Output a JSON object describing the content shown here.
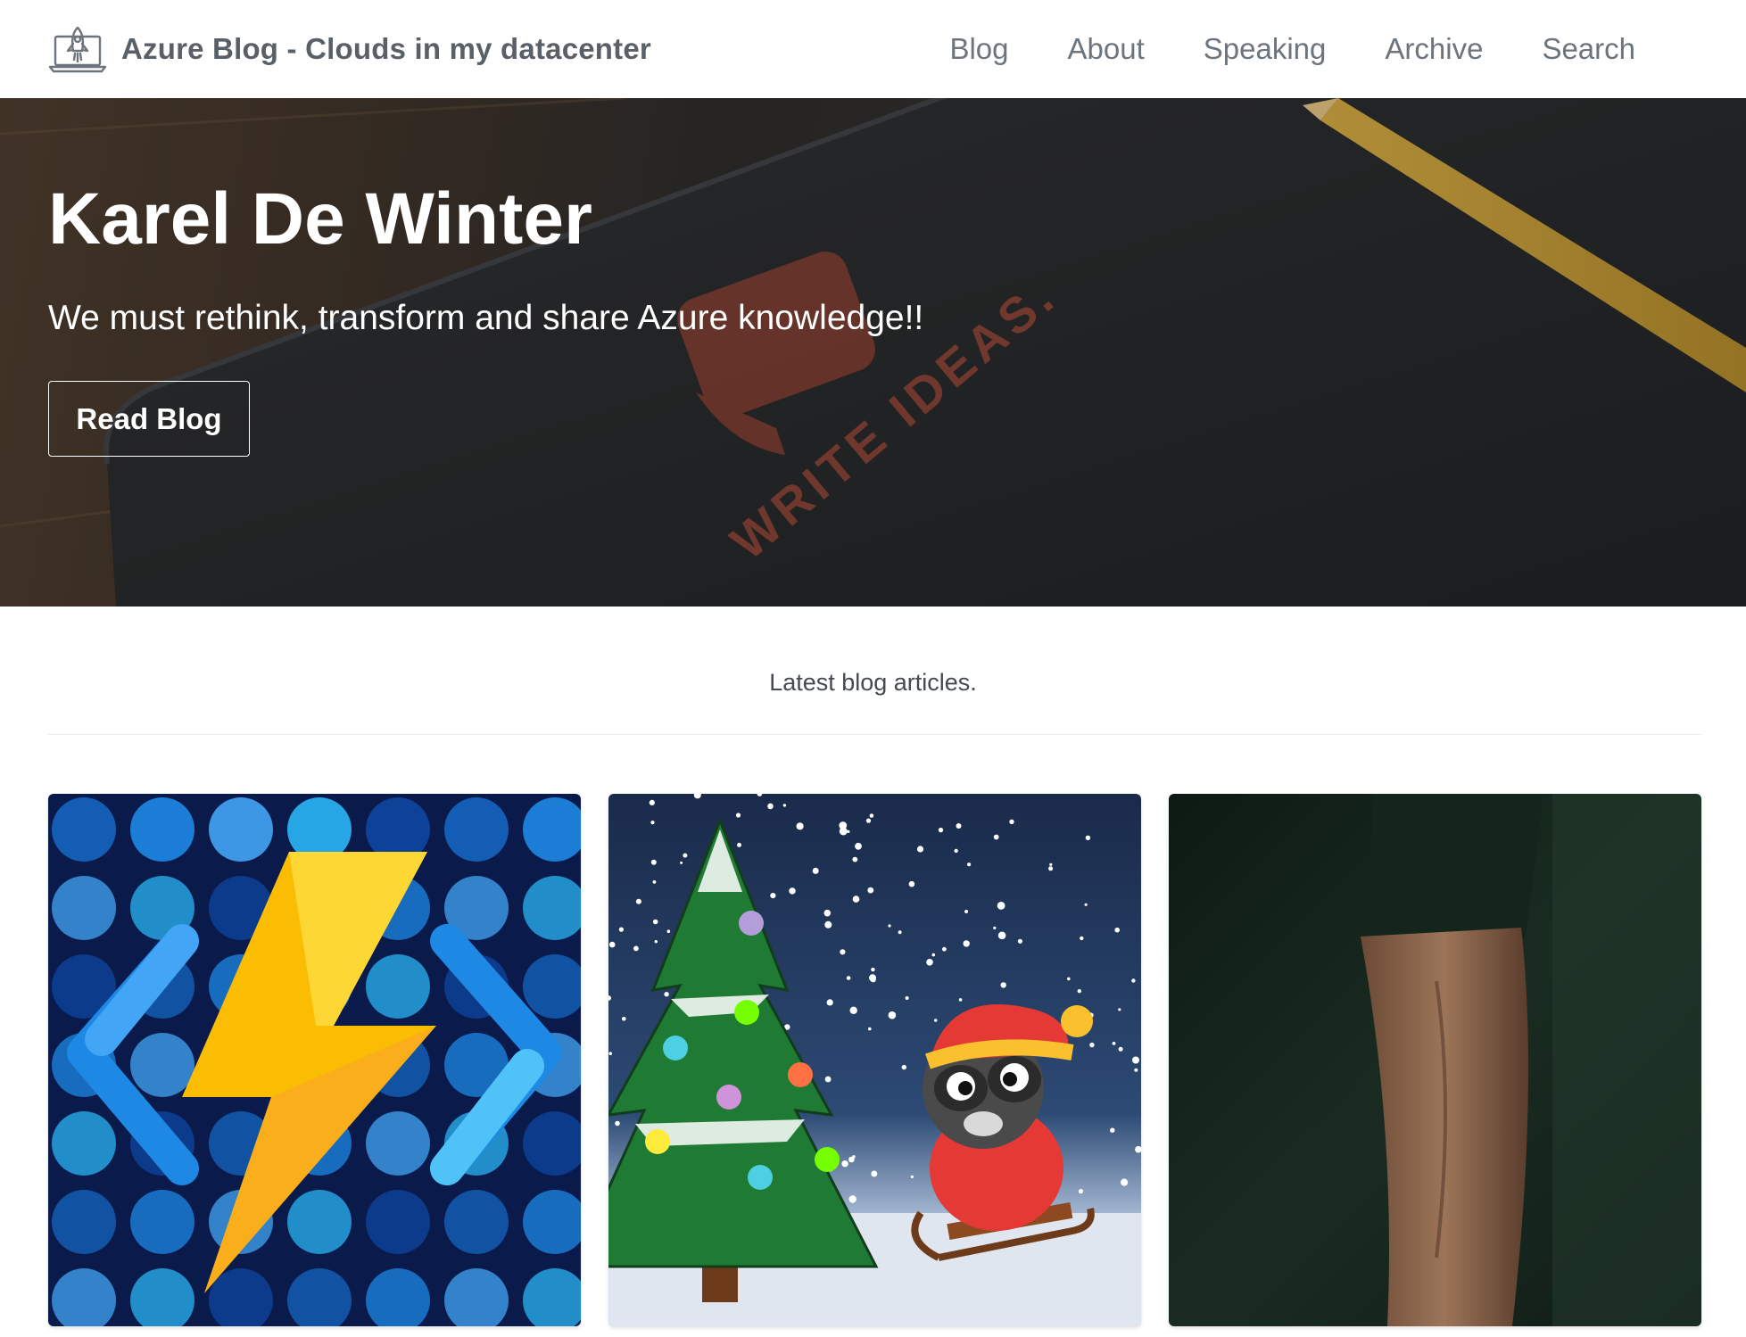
{
  "navbar": {
    "brand_title": "Azure Blog - Clouds in my datacenter",
    "brand_icon": "rocket-laptop-icon",
    "links": [
      {
        "label": "Blog"
      },
      {
        "label": "About"
      },
      {
        "label": "Speaking"
      },
      {
        "label": "Archive"
      },
      {
        "label": "Search"
      }
    ]
  },
  "hero": {
    "title": "Karel De Winter",
    "subtitle": "We must rethink, transform and share Azure knowledge!!",
    "button_label": "Read Blog",
    "background_text": "WRITE IDEAS."
  },
  "latest": {
    "heading": "Latest blog articles."
  },
  "articles": [
    {
      "image": "azure-functions-lightning-image"
    },
    {
      "image": "christmas-tree-raccoon-sled-image"
    },
    {
      "image": "arm-dark-photo-image"
    }
  ],
  "colors": {
    "nav_text": "#6c757d",
    "brand_text": "#5a6068",
    "hero_text": "#ffffff",
    "function_bolt": "#fbbc04",
    "function_brackets": "#4fc3f7"
  }
}
